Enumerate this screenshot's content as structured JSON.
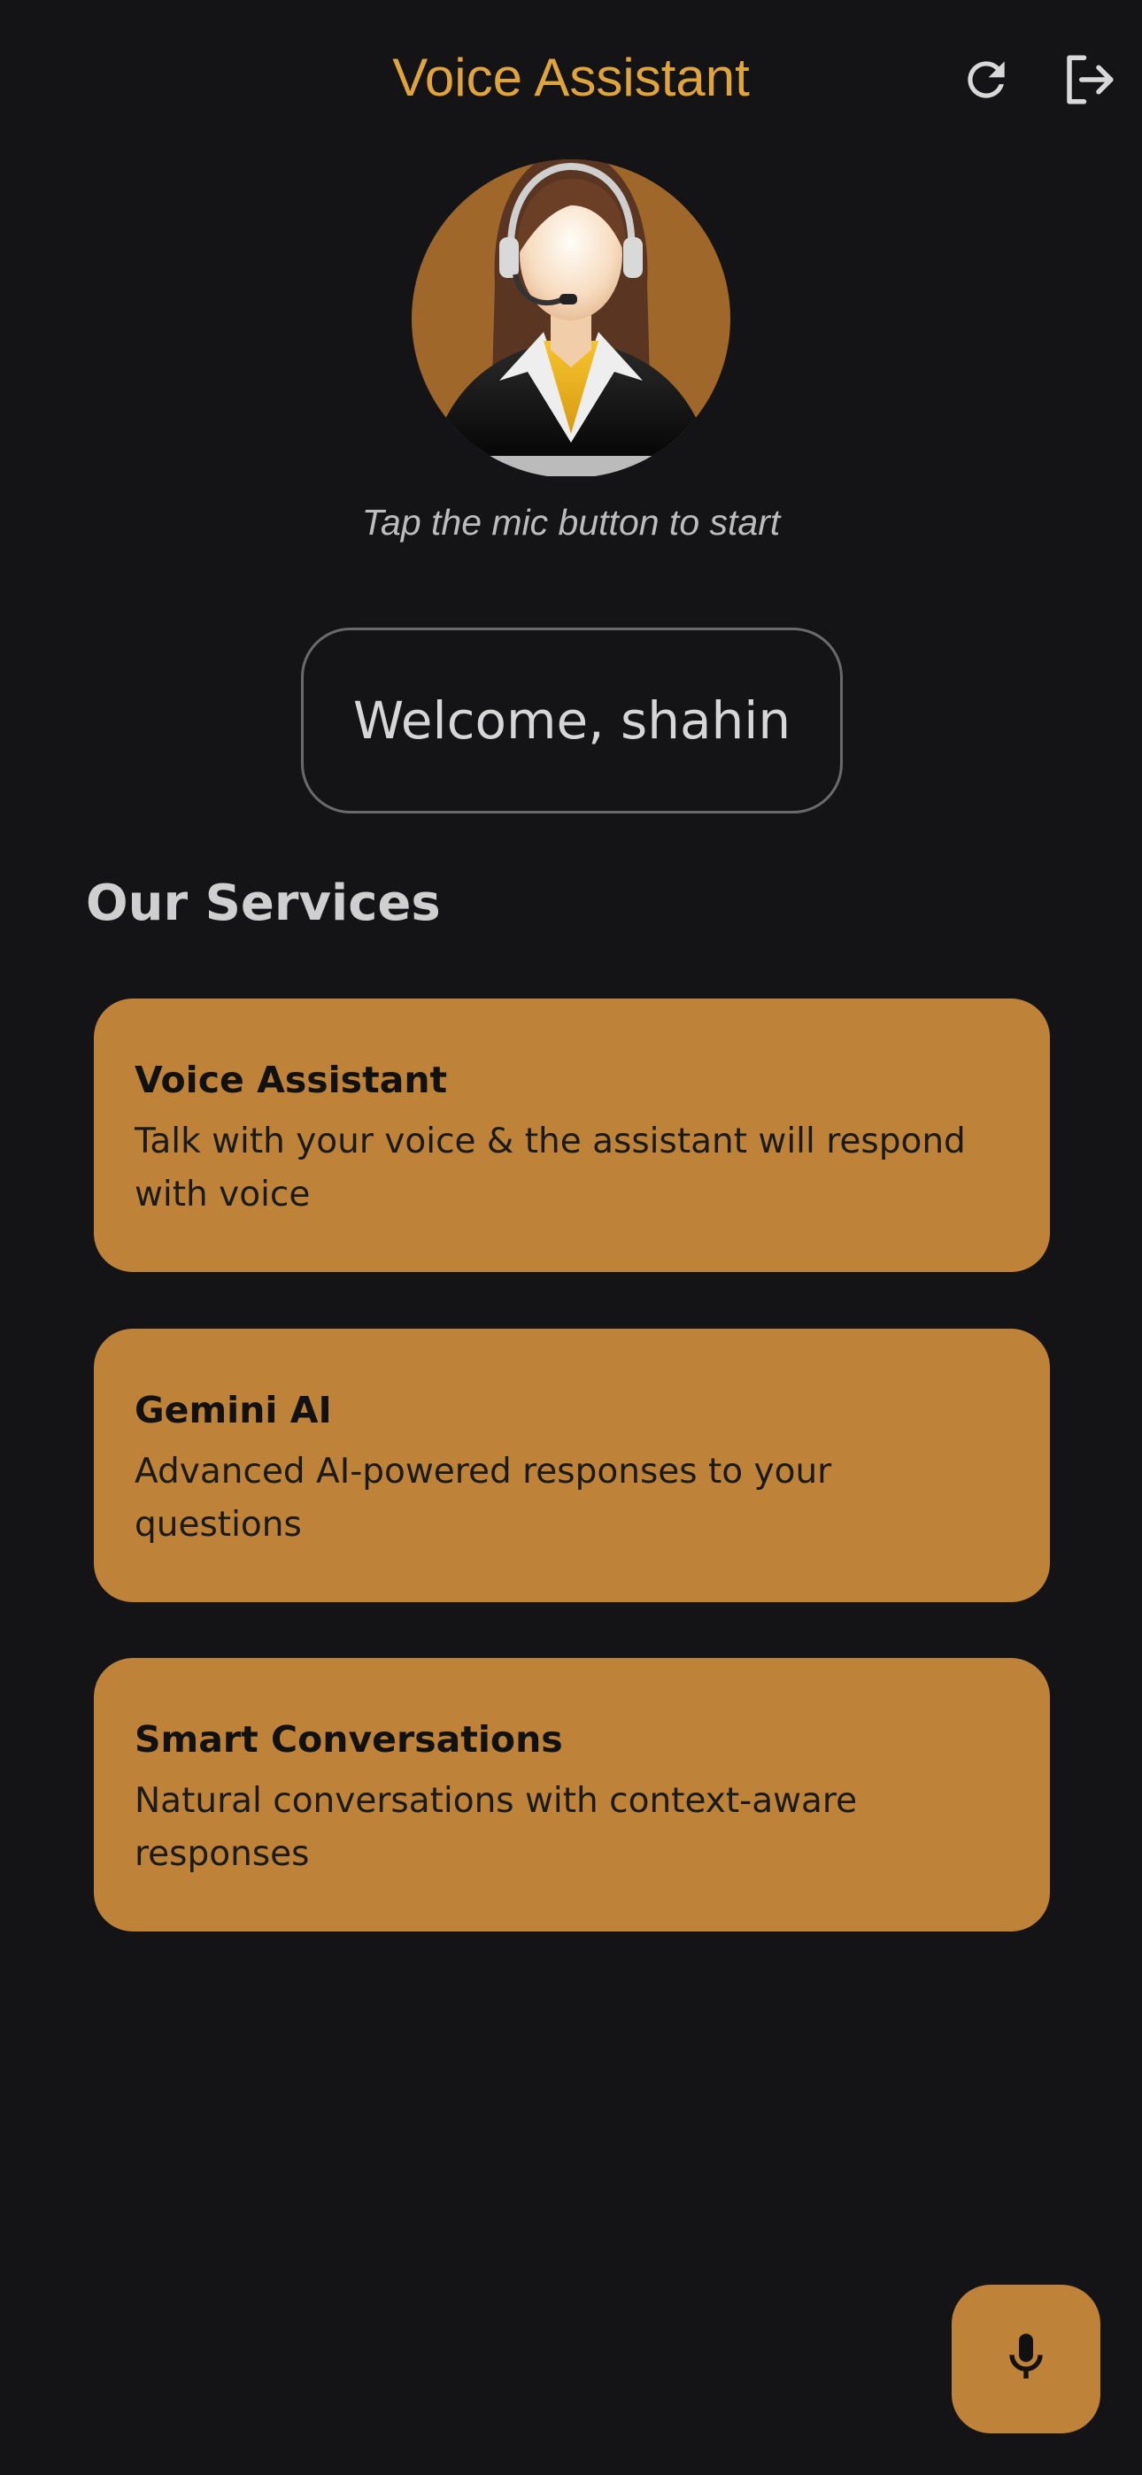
{
  "appbar": {
    "title": "Voice Assistant",
    "refresh_icon": "refresh-icon",
    "logout_icon": "logout-icon"
  },
  "hero": {
    "avatar": "customer-support-agent-avatar",
    "hint": "Tap the mic button to start"
  },
  "welcome": {
    "text": "Welcome, shahin"
  },
  "services": {
    "title": "Our Services",
    "items": [
      {
        "title": "Voice Assistant",
        "description": "Talk with your voice & the assistant will respond with voice"
      },
      {
        "title": "Gemini AI",
        "description": "Advanced AI-powered responses to your questions"
      },
      {
        "title": "Smart Conversations",
        "description": "Natural conversations with context-aware responses"
      }
    ]
  },
  "fab": {
    "icon": "microphone-icon"
  },
  "colors": {
    "background": "#141416",
    "accent": "#e0a43c",
    "card": "#be8338"
  }
}
